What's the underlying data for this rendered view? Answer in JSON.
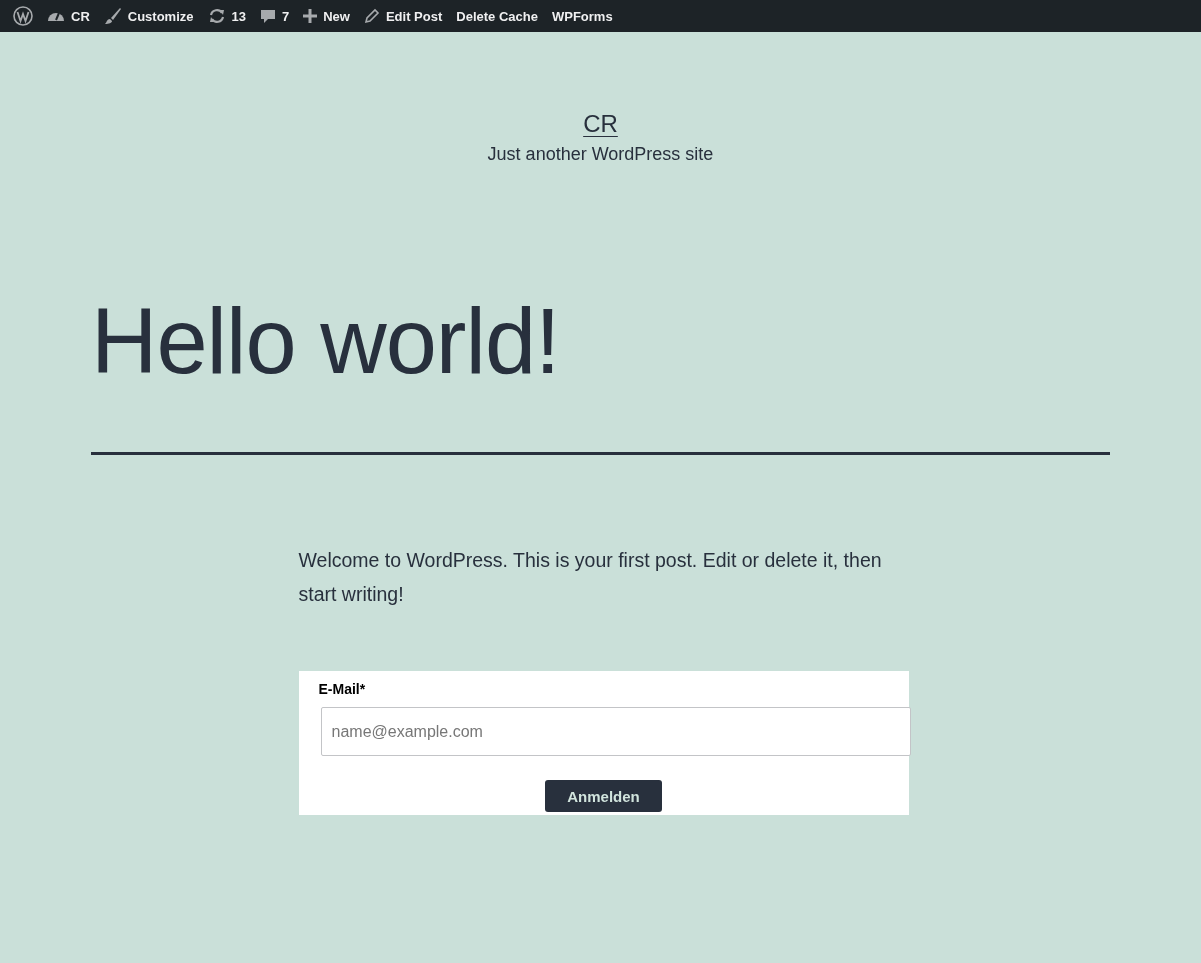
{
  "admin_bar": {
    "items": [
      {
        "kind": "logo"
      },
      {
        "kind": "site",
        "label": "CR"
      },
      {
        "kind": "customize",
        "label": "Customize"
      },
      {
        "kind": "updates",
        "label": "13"
      },
      {
        "kind": "comments",
        "label": "7"
      },
      {
        "kind": "new",
        "label": "New"
      },
      {
        "kind": "edit",
        "label": "Edit Post"
      },
      {
        "kind": "plain",
        "label": "Delete Cache"
      },
      {
        "kind": "plain",
        "label": "WPForms"
      }
    ]
  },
  "site": {
    "title": "CR",
    "tagline": "Just another WordPress site"
  },
  "post": {
    "title": "Hello world!",
    "body": "Welcome to WordPress. This is your first post. Edit or delete it, then start writing!"
  },
  "form": {
    "label": "E-Mail*",
    "placeholder": "name@example.com",
    "button": "Anmelden"
  }
}
